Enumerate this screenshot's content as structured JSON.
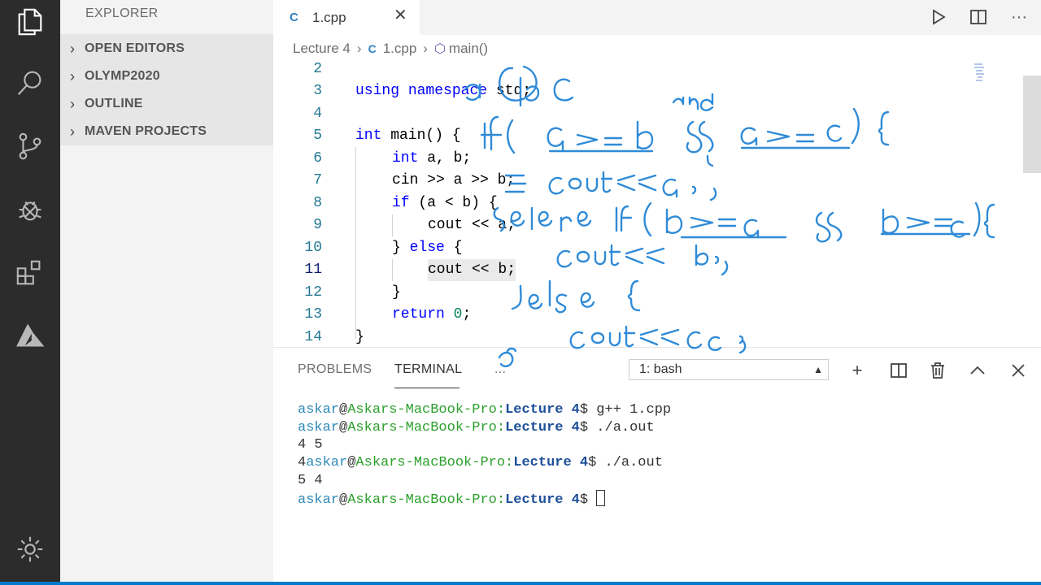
{
  "sidebar": {
    "title": "EXPLORER",
    "sections": [
      "OPEN EDITORS",
      "OLYMP2020",
      "OUTLINE",
      "MAVEN PROJECTS"
    ]
  },
  "tab": {
    "icon": "C",
    "filename": "1.cpp"
  },
  "breadcrumb": {
    "folder": "Lecture 4",
    "file": "1.cpp",
    "symbol": "main()"
  },
  "editor": {
    "lines": [
      {
        "n": "2"
      },
      {
        "n": "3"
      },
      {
        "n": "4"
      },
      {
        "n": "5"
      },
      {
        "n": "6"
      },
      {
        "n": "7"
      },
      {
        "n": "8"
      },
      {
        "n": "9"
      },
      {
        "n": "10"
      },
      {
        "n": "11"
      },
      {
        "n": "12"
      },
      {
        "n": "13"
      },
      {
        "n": "14"
      }
    ],
    "code": {
      "l3a": "using",
      "l3b": "namespace",
      "l3c": " std;",
      "l5a": "int",
      "l5b": " main() {",
      "l6a": "int",
      "l6b": " a, b;",
      "l7": "cin >> a >> b;",
      "l8a": "if",
      "l8b": " (a < b) {",
      "l9": "cout << a;",
      "l10a": "} ",
      "l10b": "else",
      "l10c": " {",
      "l11": "cout << b;",
      "l12": "}",
      "l13a": "return",
      "l13b": " ",
      "l13c": "0",
      "l13d": ";",
      "l14": "}"
    }
  },
  "panel": {
    "tabs": [
      "PROBLEMS",
      "TERMINAL",
      "..."
    ],
    "shell": "1: bash",
    "terminal": {
      "user": "askar",
      "at": "@",
      "host": "Askars-MacBook-Pro:",
      "dir": "Lecture 4",
      "prompt": "$ ",
      "cmd1": "g++ 1.cpp",
      "cmd2": "./a.out",
      "out1": "4 5",
      "out2_prefix": "4",
      "cmd3": "./a.out",
      "out3": "5 4"
    }
  },
  "icons": {
    "activity": [
      "files-icon",
      "search-icon",
      "source-control-icon",
      "debug-icon",
      "extensions-icon",
      "azure-icon",
      "gear-icon"
    ],
    "toolbar": [
      "run-icon",
      "split-editor-icon",
      "more-icon"
    ],
    "panel": [
      "add-terminal-icon",
      "split-terminal-icon",
      "trash-icon",
      "chevron-up-icon",
      "close-icon"
    ]
  },
  "colors": {
    "accent": "#007acc",
    "activity_bar": "#2c2c2c",
    "ink": "#2f8bd8"
  }
}
